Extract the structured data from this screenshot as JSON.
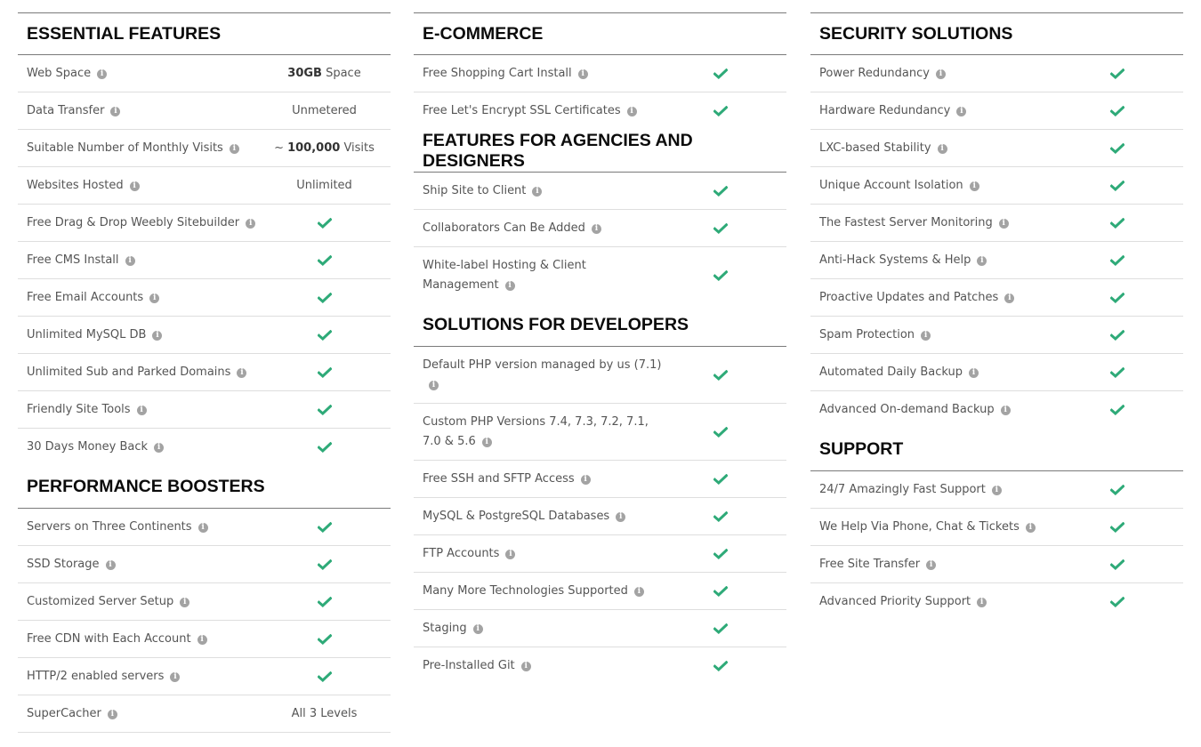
{
  "colors": {
    "check": "#2eaa78",
    "info_icon": "#a3a3a3",
    "heading": "#0b0b0b",
    "text": "#555555",
    "divider_dark": "#7a7a7a",
    "divider_light": "#dedede"
  },
  "columns": [
    {
      "sections": [
        {
          "title": "ESSENTIAL FEATURES",
          "rows": [
            {
              "label": "Web Space",
              "value_bold": "30GB",
              "value_text": " Space"
            },
            {
              "label": "Data Transfer",
              "value_text": "Unmetered"
            },
            {
              "label": "Suitable Number of Monthly Visits",
              "value_prefix": "~ ",
              "value_bold": "100,000",
              "value_text": " Visits"
            },
            {
              "label": "Websites Hosted",
              "value_text": "Unlimited"
            },
            {
              "label": "Free Drag & Drop Weebly Sitebuilder",
              "check": true
            },
            {
              "label": "Free CMS Install",
              "check": true
            },
            {
              "label": "Free Email Accounts",
              "check": true
            },
            {
              "label": "Unlimited MySQL DB",
              "check": true
            },
            {
              "label": "Unlimited Sub and Parked Domains",
              "check": true
            },
            {
              "label": "Friendly Site Tools",
              "check": true
            },
            {
              "label": "30 Days Money Back",
              "check": true
            }
          ]
        },
        {
          "title": "PERFORMANCE BOOSTERS",
          "rows": [
            {
              "label": "Servers on Three Continents",
              "check": true
            },
            {
              "label": "SSD Storage",
              "check": true
            },
            {
              "label": "Customized Server Setup",
              "check": true
            },
            {
              "label": "Free CDN with Each Account",
              "check": true
            },
            {
              "label": "HTTP/2 enabled servers",
              "check": true
            },
            {
              "label": "SuperCacher",
              "value_text": "All 3 Levels"
            }
          ]
        }
      ]
    },
    {
      "sections": [
        {
          "title": "E-COMMERCE",
          "rows": [
            {
              "label": "Free Shopping Cart Install",
              "check": true
            },
            {
              "label": "Free Let's Encrypt SSL Certificates",
              "check": true
            }
          ]
        },
        {
          "title": "FEATURES FOR AGENCIES AND DESIGNERS",
          "rows": [
            {
              "label": "Ship Site to Client",
              "check": true
            },
            {
              "label": "Collaborators Can Be Added",
              "check": true
            },
            {
              "label": "White-label Hosting & Client Management",
              "check": true
            }
          ]
        },
        {
          "title": "SOLUTIONS FOR DEVELOPERS",
          "rows": [
            {
              "label": "Default PHP version managed by us (7.1)",
              "check": true
            },
            {
              "label": "Custom PHP Versions 7.4, 7.3, 7.2, 7.1, 7.0 & 5.6",
              "check": true
            },
            {
              "label": "Free SSH and SFTP Access",
              "check": true
            },
            {
              "label": "MySQL & PostgreSQL Databases",
              "check": true
            },
            {
              "label": "FTP Accounts",
              "check": true
            },
            {
              "label": "Many More Technologies Supported",
              "check": true
            },
            {
              "label": "Staging",
              "check": true
            },
            {
              "label": "Pre-Installed Git",
              "check": true
            }
          ]
        }
      ]
    },
    {
      "sections": [
        {
          "title": "SECURITY SOLUTIONS",
          "rows": [
            {
              "label": "Power Redundancy",
              "check": true
            },
            {
              "label": "Hardware Redundancy",
              "check": true
            },
            {
              "label": "LXC-based Stability",
              "check": true
            },
            {
              "label": "Unique Account Isolation",
              "check": true
            },
            {
              "label": "The Fastest Server Monitoring",
              "check": true
            },
            {
              "label": "Anti-Hack Systems & Help",
              "check": true
            },
            {
              "label": "Proactive Updates and Patches",
              "check": true
            },
            {
              "label": "Spam Protection",
              "check": true
            },
            {
              "label": "Automated Daily Backup",
              "check": true
            },
            {
              "label": "Advanced On-demand Backup",
              "check": true
            }
          ]
        },
        {
          "title": "SUPPORT",
          "rows": [
            {
              "label": "24/7 Amazingly Fast Support",
              "check": true
            },
            {
              "label": "We Help Via Phone, Chat & Tickets",
              "check": true
            },
            {
              "label": "Free Site Transfer",
              "check": true
            },
            {
              "label": "Advanced Priority Support",
              "check": true
            }
          ]
        }
      ]
    }
  ]
}
